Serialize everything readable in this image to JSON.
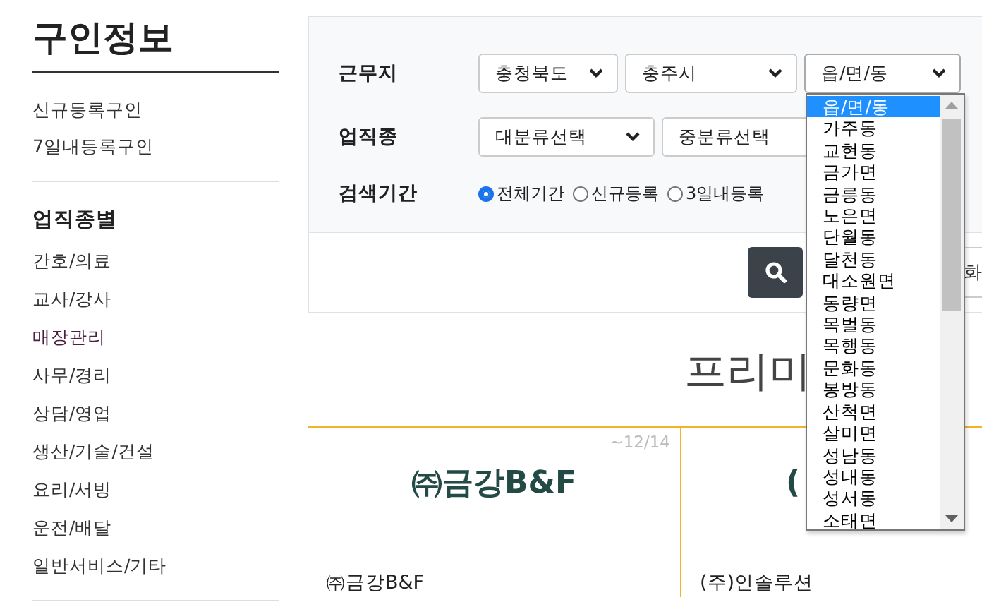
{
  "sidebar": {
    "title": "구인정보",
    "quick_links": [
      "신규등록구인",
      "7일내등록구인"
    ],
    "section_title": "업직종별",
    "categories": [
      "간호/의료",
      "교사/강사",
      "매장관리",
      "사무/경리",
      "상담/영업",
      "생산/기술/건설",
      "요리/서빙",
      "운전/배달",
      "일반서비스/기타"
    ]
  },
  "search": {
    "rows": [
      {
        "label": "근무지",
        "kind": "selects",
        "selects": [
          {
            "value": "충청북도",
            "expanded": false
          },
          {
            "value": "충주시",
            "expanded": false
          },
          {
            "value": "읍/면/동",
            "expanded": true,
            "options": [
              {
                "label": "읍/면/동",
                "selected": true
              },
              {
                "label": "가주동",
                "selected": false
              },
              {
                "label": "교현동",
                "selected": false
              },
              {
                "label": "금가면",
                "selected": false
              },
              {
                "label": "금릉동",
                "selected": false
              },
              {
                "label": "노은면",
                "selected": false
              },
              {
                "label": "단월동",
                "selected": false
              },
              {
                "label": "달천동",
                "selected": false
              },
              {
                "label": "대소원면",
                "selected": false
              },
              {
                "label": "동량면",
                "selected": false
              },
              {
                "label": "목벌동",
                "selected": false
              },
              {
                "label": "목행동",
                "selected": false
              },
              {
                "label": "문화동",
                "selected": false
              },
              {
                "label": "봉방동",
                "selected": false
              },
              {
                "label": "산척면",
                "selected": false
              },
              {
                "label": "살미면",
                "selected": false
              },
              {
                "label": "성남동",
                "selected": false
              },
              {
                "label": "성내동",
                "selected": false
              },
              {
                "label": "성서동",
                "selected": false
              },
              {
                "label": "소태면",
                "selected": false
              }
            ]
          }
        ]
      },
      {
        "label": "업직종",
        "kind": "selects",
        "selects": [
          {
            "value": "대분류선택",
            "expanded": false
          },
          {
            "value": "중분류선택",
            "expanded": false
          }
        ]
      },
      {
        "label": "검색기간",
        "kind": "radios",
        "options": [
          {
            "label": "전체기간",
            "selected": true
          },
          {
            "label": "신규등록",
            "selected": false
          },
          {
            "label": "3일내등록",
            "selected": false
          }
        ]
      }
    ],
    "buttons": [
      {
        "kind": "search"
      },
      {
        "kind": "reset",
        "label": "화"
      }
    ]
  },
  "premium": {
    "title": "프리미"
  },
  "cards": [
    {
      "logo": "㈜금강B&F",
      "date": "~12/14",
      "name": "㈜금강B&F"
    },
    {
      "logo": "(",
      "name": "(주)인솔루션"
    }
  ]
}
